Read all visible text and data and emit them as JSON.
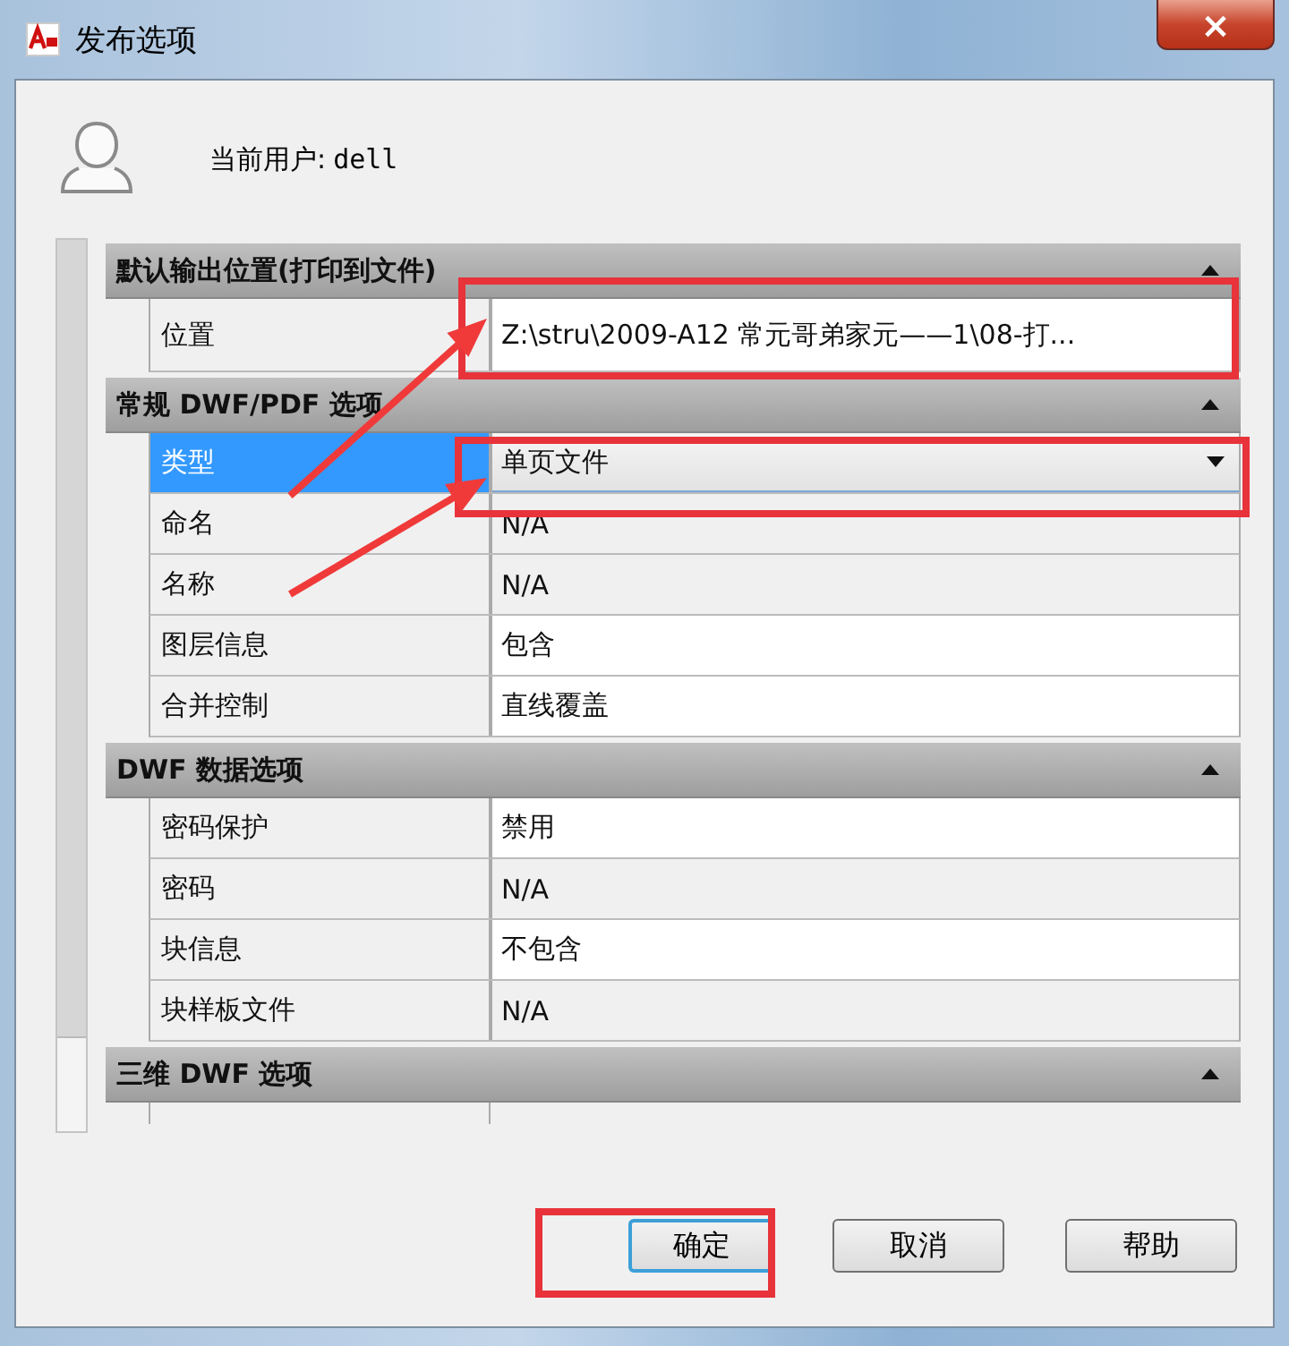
{
  "window": {
    "title": "发布选项",
    "close": "×"
  },
  "user": {
    "label": "当前用户:",
    "name": "dell"
  },
  "sections": [
    {
      "title": "默认输出位置(打印到文件)",
      "expanded": true,
      "rows": [
        {
          "label": "位置",
          "value": "Z:\\stru\\2009-A12 常元哥弟家元——1\\08-打...",
          "kind": "text",
          "disabled": false,
          "selected": false
        }
      ]
    },
    {
      "title": "常规 DWF/PDF 选项",
      "expanded": true,
      "rows": [
        {
          "label": "类型",
          "value": "单页文件",
          "kind": "dropdown",
          "selected": true
        },
        {
          "label": "命名",
          "value": "N/A",
          "kind": "text",
          "disabled": true,
          "selected": false
        },
        {
          "label": "名称",
          "value": "N/A",
          "kind": "text",
          "disabled": true,
          "selected": false
        },
        {
          "label": "图层信息",
          "value": "包含",
          "kind": "text",
          "disabled": false,
          "selected": false
        },
        {
          "label": "合并控制",
          "value": "直线覆盖",
          "kind": "text",
          "disabled": false,
          "selected": false
        }
      ]
    },
    {
      "title": "DWF 数据选项",
      "expanded": true,
      "rows": [
        {
          "label": "密码保护",
          "value": "禁用",
          "kind": "text",
          "disabled": false,
          "selected": false
        },
        {
          "label": "密码",
          "value": "N/A",
          "kind": "text",
          "disabled": true,
          "selected": false
        },
        {
          "label": "块信息",
          "value": "不包含",
          "kind": "text",
          "disabled": false,
          "selected": false
        },
        {
          "label": "块样板文件",
          "value": "N/A",
          "kind": "text",
          "disabled": true,
          "selected": false
        }
      ]
    },
    {
      "title": "三维 DWF 选项",
      "expanded": true
    }
  ],
  "buttons": [
    {
      "label": "确定",
      "default": true
    },
    {
      "label": "取消",
      "default": false
    },
    {
      "label": "帮助",
      "default": false
    }
  ]
}
